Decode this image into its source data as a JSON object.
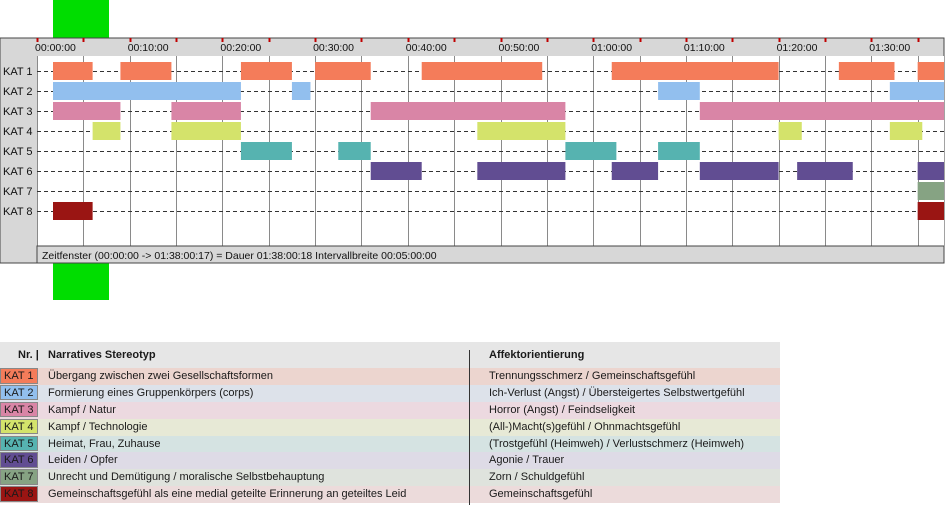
{
  "chart_data": {
    "type": "timeline",
    "time_axis": {
      "start": "00:00:00",
      "end": "01:38:00",
      "tick_labels": [
        "00:00:00",
        "00:10:00",
        "00:20:00",
        "00:30:00",
        "00:40:00",
        "00:50:00",
        "01:00:00",
        "01:10:00",
        "01:20:00",
        "01:30:00"
      ],
      "minor_interval_minutes": 5
    },
    "rows": [
      {
        "label": "KAT 1",
        "color": "#f47c5a",
        "segments": [
          [
            "00:00:00",
            "00:06:00"
          ],
          [
            "00:09:00",
            "00:14:30"
          ],
          [
            "00:22:00",
            "00:27:30"
          ],
          [
            "00:30:00",
            "00:36:00"
          ],
          [
            "00:41:30",
            "00:54:30"
          ],
          [
            "01:02:00",
            "01:20:00"
          ],
          [
            "01:26:30",
            "01:32:30"
          ],
          [
            "01:35:00",
            "01:38:00"
          ]
        ]
      },
      {
        "label": "KAT 2",
        "color": "#92bfee",
        "segments": [
          [
            "00:00:00",
            "00:22:00"
          ],
          [
            "00:27:30",
            "00:29:30"
          ],
          [
            "01:07:00",
            "01:11:30"
          ],
          [
            "01:32:00",
            "01:38:00"
          ]
        ]
      },
      {
        "label": "KAT 3",
        "color": "#d985a6",
        "segments": [
          [
            "00:00:00",
            "00:09:00"
          ],
          [
            "00:14:30",
            "00:22:00"
          ],
          [
            "00:36:00",
            "00:57:00"
          ],
          [
            "01:11:30",
            "01:38:00"
          ]
        ]
      },
      {
        "label": "KAT 4",
        "color": "#d4e36b",
        "segments": [
          [
            "00:06:00",
            "00:09:00"
          ],
          [
            "00:14:30",
            "00:22:00"
          ],
          [
            "00:47:30",
            "00:57:00"
          ],
          [
            "01:20:00",
            "01:22:30"
          ],
          [
            "01:32:00",
            "01:35:30"
          ]
        ]
      },
      {
        "label": "KAT 5",
        "color": "#56b3b0",
        "segments": [
          [
            "00:22:00",
            "00:27:30"
          ],
          [
            "00:32:30",
            "00:36:00"
          ],
          [
            "00:57:00",
            "01:02:30"
          ],
          [
            "01:07:00",
            "01:11:30"
          ]
        ]
      },
      {
        "label": "KAT 6",
        "color": "#614d92",
        "segments": [
          [
            "00:36:00",
            "00:41:30"
          ],
          [
            "00:47:30",
            "00:57:00"
          ],
          [
            "01:02:00",
            "01:07:00"
          ],
          [
            "01:11:30",
            "01:20:00"
          ],
          [
            "01:22:00",
            "01:28:00"
          ],
          [
            "01:35:00",
            "01:38:00"
          ]
        ]
      },
      {
        "label": "KAT 7",
        "color": "#86a383",
        "segments": [
          [
            "01:35:00",
            "01:38:00"
          ]
        ]
      },
      {
        "label": "KAT 8",
        "color": "#9a1513",
        "segments": [
          [
            "00:00:00",
            "00:06:00"
          ],
          [
            "01:35:00",
            "01:38:00"
          ]
        ]
      }
    ],
    "status_text": "Zeitfenster (00:00:00 -> 01:38:00:17) = Dauer 01:38:00:18    Intervallbreite 00:05:00:00"
  },
  "legend": {
    "header_nr": "Nr. |",
    "header_desc": "Narratives Stereotyp",
    "header_aff": "Affektorientierung",
    "rows": [
      {
        "nr": "KAT 1",
        "color": "#f47c5a",
        "bg": "#ecd5cf",
        "desc": "Übergang zwischen zwei Gesellschaftsformen",
        "aff": "Trennungsschmerz / Gemeinschaftsgefühl"
      },
      {
        "nr": "KAT 2",
        "color": "#92bfee",
        "bg": "#dde2ea",
        "desc": "Formierung eines Gruppenkörpers (corps)",
        "aff": "Ich-Verlust (Angst) / Übersteigertes Selbstwertgefühl"
      },
      {
        "nr": "KAT 3",
        "color": "#d985a6",
        "bg": "#ecd9e0",
        "desc": "Kampf / Natur",
        "aff": "Horror (Angst) / Feindseligkeit"
      },
      {
        "nr": "KAT 4",
        "color": "#d4e36b",
        "bg": "#e7e9d6",
        "desc": "Kampf / Technologie",
        "aff": "(All-)Macht(s)gefühl / Ohnmachtsgefühl"
      },
      {
        "nr": "KAT 5",
        "color": "#56b3b0",
        "bg": "#d5e3e2",
        "desc": "Heimat, Frau, Zuhause",
        "aff": "(Trostgefühl (Heimweh) / Verlustschmerz (Heimweh)"
      },
      {
        "nr": "KAT 6",
        "color": "#614d92",
        "bg": "#dedbe6",
        "desc": "Leiden / Opfer",
        "aff": "Agonie / Trauer"
      },
      {
        "nr": "KAT 7",
        "color": "#86a383",
        "bg": "#dfe3dd",
        "desc": "Unrecht und Demütigung / moralische Selbstbehauptung",
        "aff": "Zorn / Schuldgefühl"
      },
      {
        "nr": "KAT 8",
        "color": "#9a1513",
        "bg": "#ecdbdb",
        "desc": "Gemeinschaftsgefühl als eine medial geteilte Erinnerung an geteiltes Leid",
        "aff": "Gemeinschaftsgefühl"
      }
    ]
  }
}
